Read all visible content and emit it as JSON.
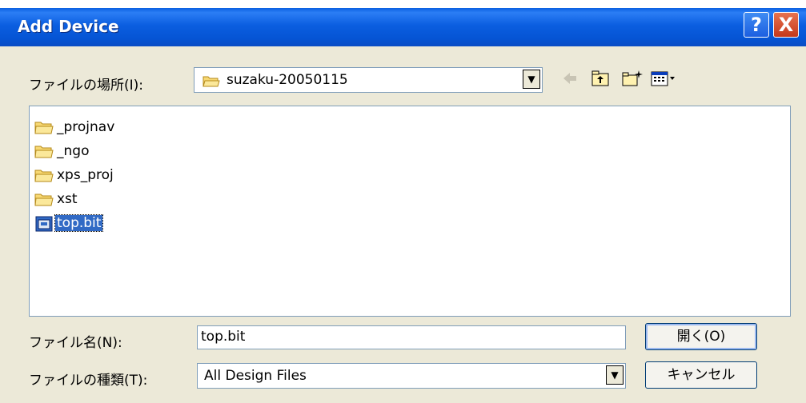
{
  "window": {
    "title": "Add Device"
  },
  "lookin": {
    "label": "ファイルの場所(I):",
    "value": "suzaku-20050115"
  },
  "files": [
    {
      "name": "_projnav",
      "type": "folder",
      "selected": false
    },
    {
      "name": "_ngo",
      "type": "folder",
      "selected": false
    },
    {
      "name": "xps_proj",
      "type": "folder",
      "selected": false
    },
    {
      "name": "xst",
      "type": "folder",
      "selected": false
    },
    {
      "name": "top.bit",
      "type": "file",
      "selected": true
    }
  ],
  "filename": {
    "label": "ファイル名(N):",
    "value": "top.bit"
  },
  "filetype": {
    "label": "ファイルの種類(T):",
    "value": "All Design Files"
  },
  "buttons": {
    "open": "開く(O)",
    "cancel": "キャンセル"
  },
  "icons": {
    "help": "?",
    "close": "X",
    "dropdown": "▼"
  },
  "colors": {
    "titlebar": "#0554d4",
    "dialog_bg": "#ece9d8",
    "selection": "#316ac5"
  }
}
